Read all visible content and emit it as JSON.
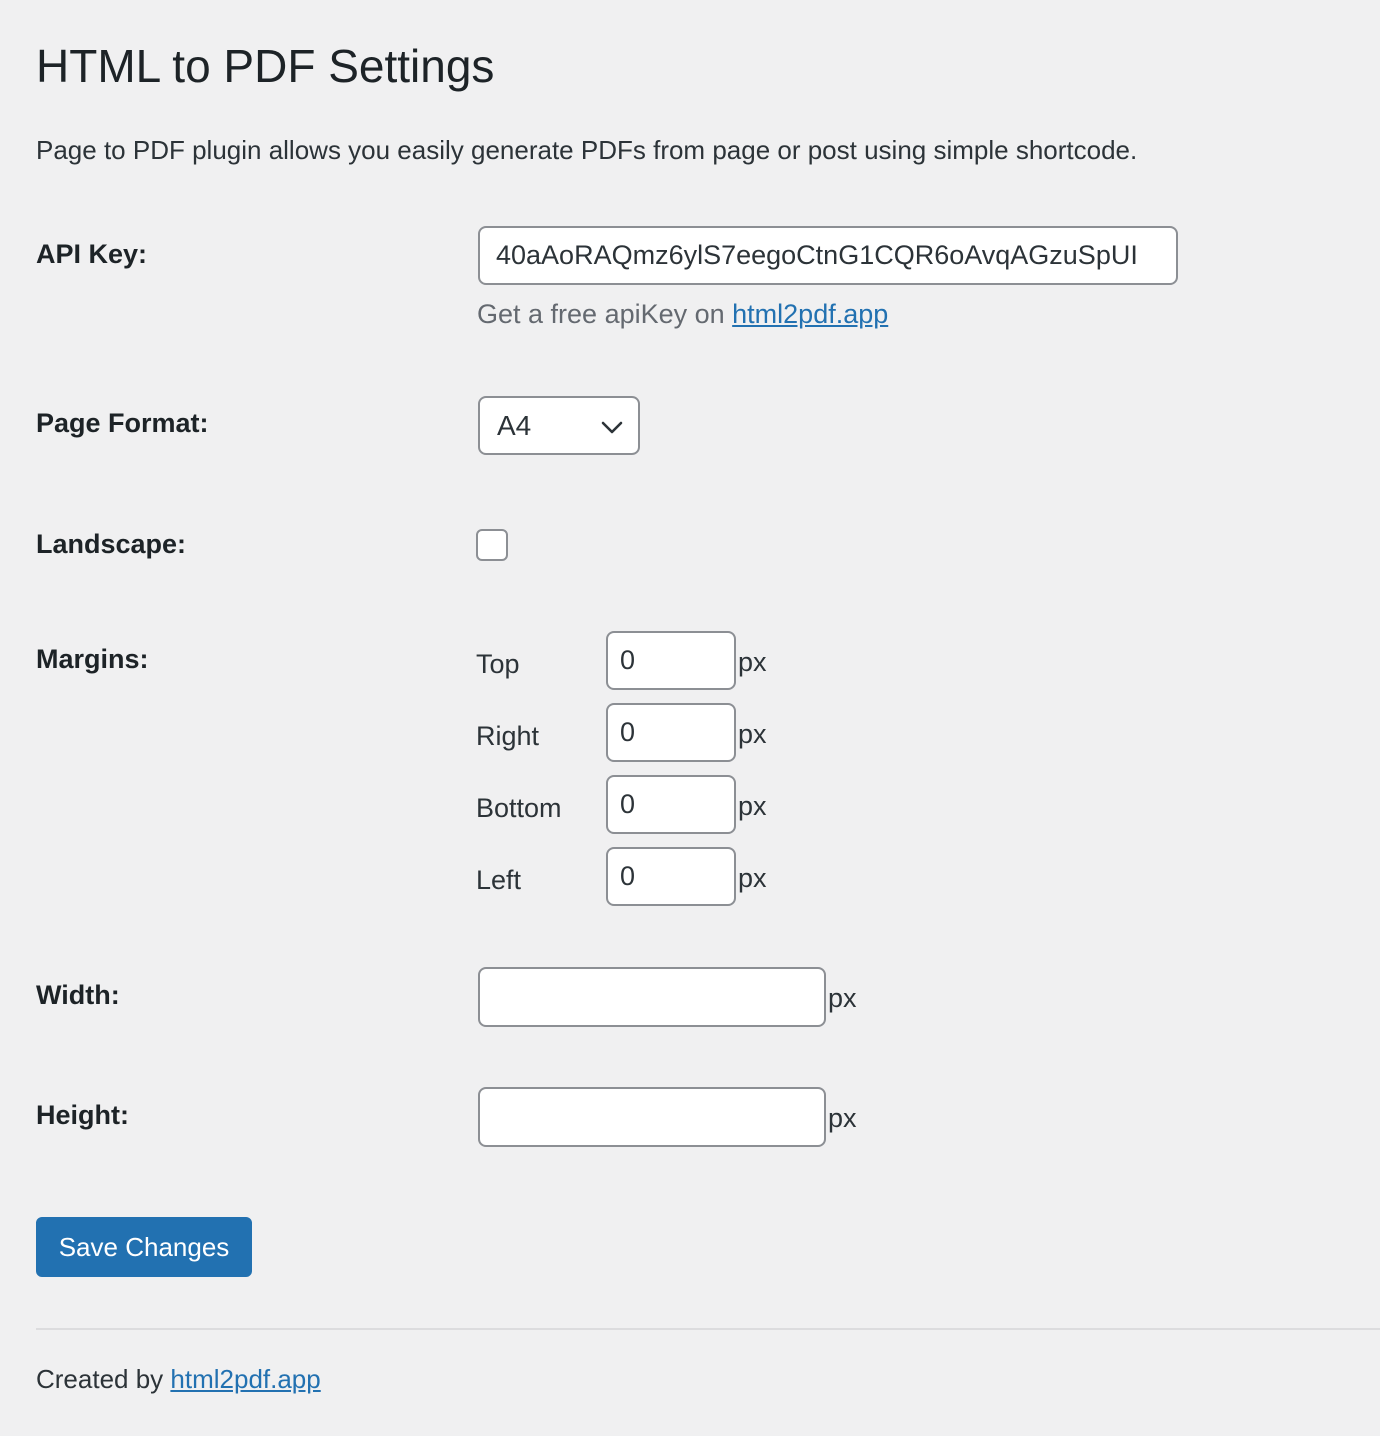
{
  "page": {
    "title": "HTML to PDF Settings",
    "description": "Page to PDF plugin allows you easily generate PDFs from page or post using simple shortcode."
  },
  "api_key": {
    "label": "API Key:",
    "value": "40aAoRAQmz6ylS7eegoCtnG1CQR6oAvqAGzuSpUI",
    "help_prefix": "Get a free apiKey on ",
    "help_link": "html2pdf.app"
  },
  "page_format": {
    "label": "Page Format:",
    "selected": "A4",
    "icon": "chevron-down-icon"
  },
  "landscape": {
    "label": "Landscape:",
    "checked": false
  },
  "margins": {
    "label": "Margins:",
    "unit": "px",
    "items": [
      {
        "label": "Top",
        "value": "0"
      },
      {
        "label": "Right",
        "value": "0"
      },
      {
        "label": "Bottom",
        "value": "0"
      },
      {
        "label": "Left",
        "value": "0"
      }
    ]
  },
  "width": {
    "label": "Width:",
    "value": "",
    "unit": "px"
  },
  "height": {
    "label": "Height:",
    "value": "",
    "unit": "px"
  },
  "actions": {
    "save_label": "Save Changes"
  },
  "footer": {
    "prefix": "Created by ",
    "link": "html2pdf.app"
  },
  "colors": {
    "background": "#f0f0f1",
    "accent": "#2271b1",
    "border": "#8c8f94",
    "muted_text": "#646970"
  }
}
